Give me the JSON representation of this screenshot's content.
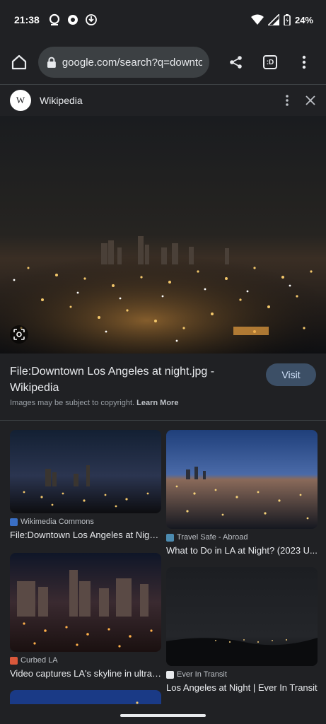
{
  "status_bar": {
    "time": "21:38",
    "battery": "24%"
  },
  "toolbar": {
    "url": "google.com/search?q=downto",
    "tab_icon_text": ":D"
  },
  "source": {
    "logo_letter": "W",
    "name": "Wikipedia"
  },
  "result": {
    "title": "File:Downtown Los Angeles at night.jpg - Wikipedia",
    "visit_label": "Visit",
    "copyright_text": "Images may be subject to copyright.",
    "learn_more": "Learn More"
  },
  "related": [
    {
      "source": "Wikimedia Commons",
      "title": "File:Downtown Los Angeles at Nigh...",
      "favicon_color": "#3a6fc4"
    },
    {
      "source": "Travel Safe - Abroad",
      "title": "What to Do in LA at Night? (2023 U...",
      "favicon_color": "#4c8bb0"
    },
    {
      "source": "Curbed LA",
      "title": "Video captures LA's skyline in ultra ...",
      "favicon_color": "#d9583b"
    },
    {
      "source": "Ever In Transit",
      "title": "Los Angeles at Night | Ever In Transit",
      "favicon_color": "#e8eaed"
    }
  ]
}
